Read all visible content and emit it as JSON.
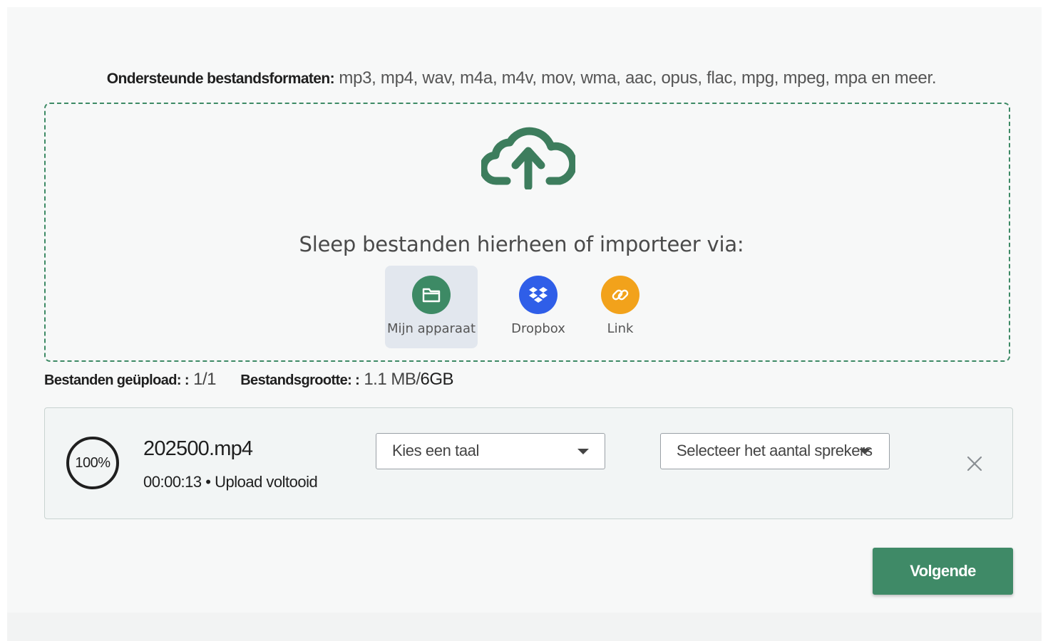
{
  "upload": {
    "formats_label": "Ondersteunde bestandsformaten:",
    "formats_list": "mp3, mp4, wav, m4a, m4v, mov, wma, aac, opus, flac, mpg, mpeg, mpa en meer.",
    "drop_text": "Sleep bestanden hierheen of importeer via:",
    "sources": [
      {
        "label": "Mijn apparaat",
        "icon": "folder-icon",
        "color": "#3d8a65"
      },
      {
        "label": "Dropbox",
        "icon": "dropbox-icon",
        "color": "#2f5ee8"
      },
      {
        "label": "Link",
        "icon": "link-icon",
        "color": "#f2a21b"
      }
    ]
  },
  "stats": {
    "uploaded_label": "Bestanden geüpload: :",
    "uploaded_value": "1/1",
    "size_label": "Bestandsgrootte: :",
    "size_used": "1.1 MB",
    "size_limit": "6GB"
  },
  "file": {
    "progress_text": "100%",
    "progress": 1.0,
    "name": "202500.mp4",
    "duration": "00:00:13",
    "separator": "•",
    "status": "Upload voltooid",
    "language_select": "Kies een taal",
    "speakers_select": "Selecteer het aantal sprekers"
  },
  "actions": {
    "next_label": "Volgende"
  },
  "colors": {
    "accent": "#3f8a67",
    "dropbox": "#2f5ee8",
    "link": "#f2a21b"
  }
}
